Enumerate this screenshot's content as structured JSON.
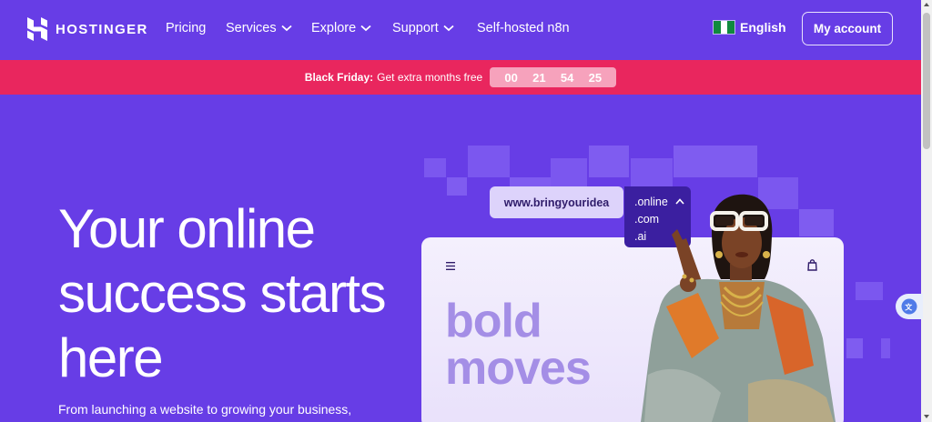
{
  "brand": {
    "name": "HOSTINGER"
  },
  "nav": {
    "items": [
      {
        "label": "Pricing",
        "has_dropdown": false
      },
      {
        "label": "Services",
        "has_dropdown": true
      },
      {
        "label": "Explore",
        "has_dropdown": true
      },
      {
        "label": "Support",
        "has_dropdown": true
      },
      {
        "label": "Self-hosted n8n",
        "has_dropdown": false
      }
    ],
    "language": "English",
    "account_label": "My account"
  },
  "promo": {
    "title": "Black Friday:",
    "text": "Get extra months free",
    "timer": [
      "00",
      "21",
      "54",
      "25"
    ]
  },
  "hero": {
    "title": "Your online success starts here",
    "subtitle": "From launching a website to growing your business,"
  },
  "domain_search": {
    "value": "www.bringyouridea",
    "tlds": [
      ".online",
      ".com",
      ".ai"
    ]
  },
  "mockup": {
    "headline_line1": "bold",
    "headline_line2": "moves"
  },
  "icons": {
    "logo": "hostinger-logo-icon",
    "flag": "nigeria-flag-icon",
    "menu": "hamburger-menu-icon",
    "cart": "shopping-bag-icon",
    "translate": "translate-icon"
  },
  "colors": {
    "brand_purple": "#673de6",
    "promo_pink": "#e9265e",
    "dark_purple": "#3b1fa0",
    "pill_lavender": "#ddd3fb",
    "headline_lavender": "#a48ee6"
  }
}
